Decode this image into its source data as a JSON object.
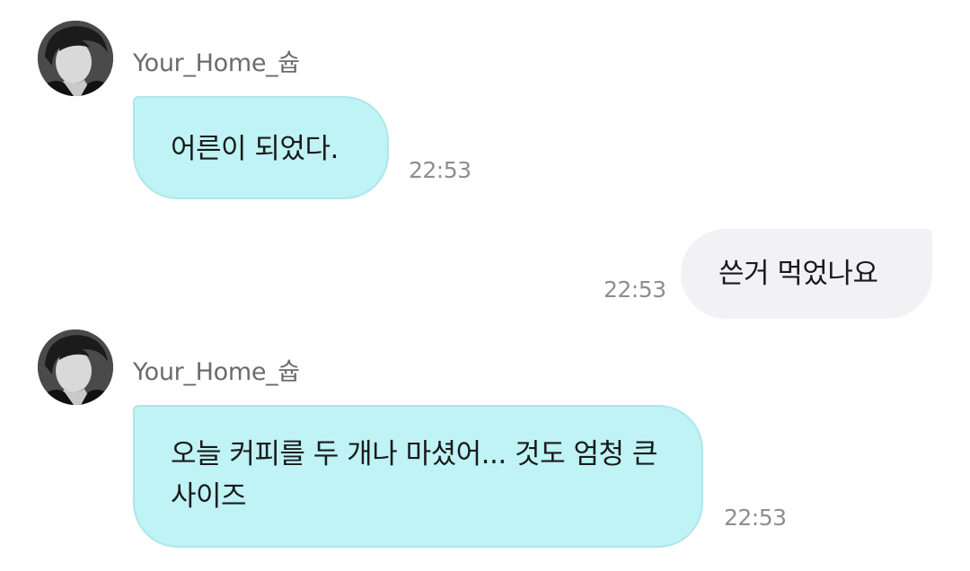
{
  "messages": [
    {
      "direction": "incoming",
      "sender": "Your_Home_슙",
      "text": "어른이 되었다.",
      "time": "22:53"
    },
    {
      "direction": "outgoing",
      "text": "쓴거 먹었나요",
      "time": "22:53"
    },
    {
      "direction": "incoming",
      "sender": "Your_Home_슙",
      "text": "오늘 커피를 두 개나 마셨어... 것도 엄청 큰 사이즈",
      "time": "22:53"
    }
  ],
  "colors": {
    "incoming_bubble": "#bff3f5",
    "outgoing_bubble": "#f2f2f5",
    "timestamp": "#8e8e8e",
    "sender_name": "#6b6b6b"
  },
  "icons": {
    "avatar": "profile-photo-avatar"
  }
}
